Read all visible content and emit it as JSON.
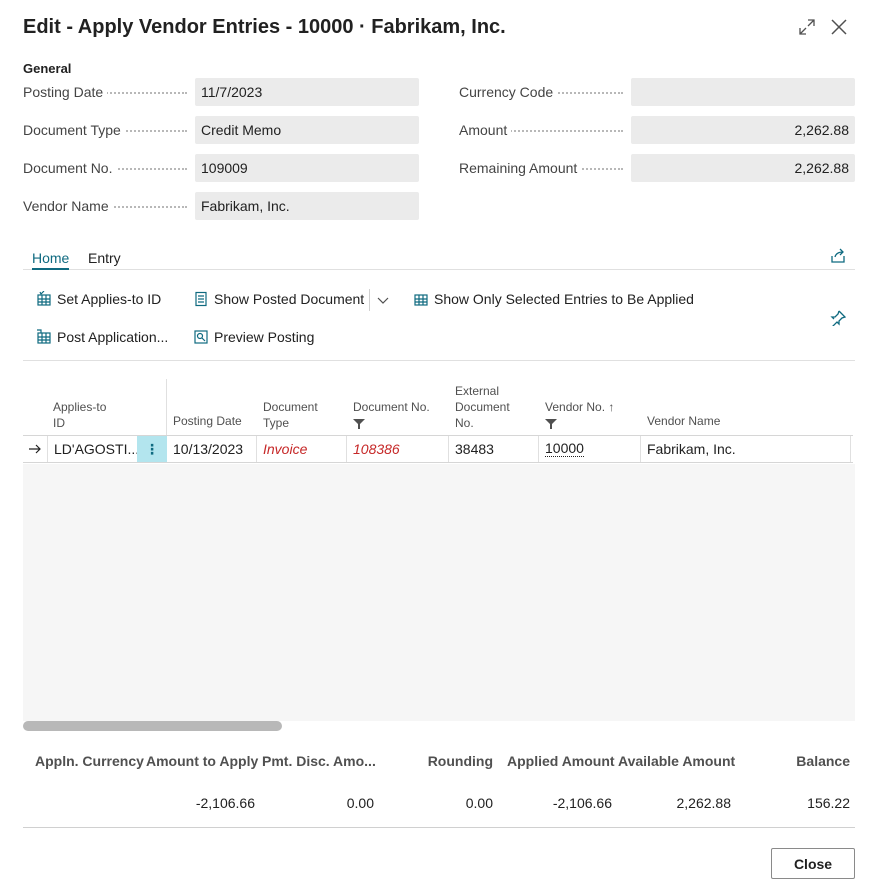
{
  "window": {
    "title": "Edit - Apply Vendor Entries - 10000 · Fabrikam, Inc."
  },
  "general": {
    "section_label": "General",
    "left": [
      {
        "label": "Posting Date",
        "value": "11/7/2023"
      },
      {
        "label": "Document Type",
        "value": "Credit Memo"
      },
      {
        "label": "Document No.",
        "value": "109009"
      },
      {
        "label": "Vendor Name",
        "value": "Fabrikam, Inc."
      }
    ],
    "right": [
      {
        "label": "Currency Code",
        "value": ""
      },
      {
        "label": "Amount",
        "value": "2,262.88"
      },
      {
        "label": "Remaining Amount",
        "value": "2,262.88"
      }
    ]
  },
  "tabs": [
    {
      "label": "Home"
    },
    {
      "label": "Entry"
    }
  ],
  "actions": {
    "set_applies_to_id": "Set Applies-to ID",
    "show_posted_document": "Show Posted Document",
    "show_only_selected": "Show Only Selected Entries to Be Applied",
    "post_application": "Post Application...",
    "preview_posting": "Preview Posting"
  },
  "grid": {
    "headers": {
      "applies_to_id": [
        "Applies-to",
        "ID"
      ],
      "posting_date": "Posting Date",
      "document_type": [
        "Document",
        "Type"
      ],
      "document_no": "Document No.",
      "external_document_no": [
        "External",
        "Document",
        "No."
      ],
      "vendor_no": "Vendor No. ↑",
      "vendor_name": "Vendor Name"
    },
    "rows": [
      {
        "applies_to_id": "LD'AGOSTI...",
        "posting_date": "10/13/2023",
        "document_type": "Invoice",
        "document_no": "108386",
        "external_document_no": "38483",
        "vendor_no": "10000",
        "vendor_name": "Fabrikam, Inc."
      }
    ]
  },
  "totals": {
    "headers": {
      "appln_currency": "Appln. Currency",
      "amount_to_apply": "Amount to Apply",
      "pmt_disc": "Pmt. Disc. Amo...",
      "rounding": "Rounding",
      "applied_amount": "Applied Amount",
      "available_amount": "Available Amount",
      "balance": "Balance"
    },
    "values": {
      "appln_currency": "",
      "amount_to_apply": "-2,106.66",
      "pmt_disc": "0.00",
      "rounding": "0.00",
      "applied_amount": "-2,106.66",
      "available_amount": "2,262.88",
      "balance": "156.22"
    }
  },
  "footer": {
    "close_label": "Close"
  },
  "colors": {
    "accent": "#0f6a80",
    "link_red": "#c62828",
    "field_bg": "#ebebeb",
    "selected_cell": "#b3e5ee"
  }
}
